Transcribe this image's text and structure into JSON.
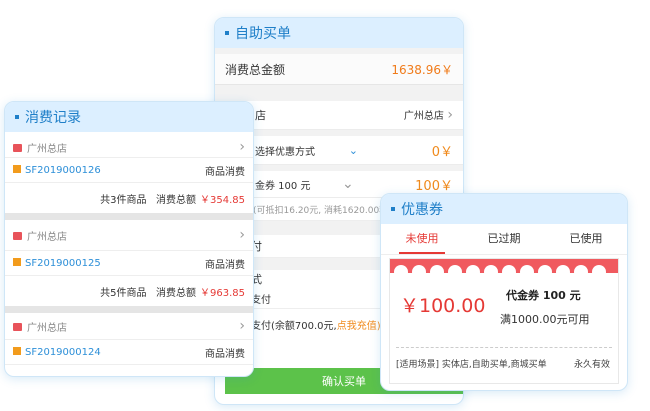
{
  "order": {
    "title": "自助买单",
    "total_label": "消费总金额",
    "total_value": "1638.96￥",
    "store_label": "店",
    "store_value": "广州总店",
    "discount_label": "选择优惠方式",
    "discount_value": "0￥",
    "coupon_label": "金券 100 元",
    "coupon_value": "100￥",
    "points_text": "(可抵扣16.20元, 消耗1620.00积",
    "pay_label_a": "付",
    "pay_label_b": "式",
    "pay_option_1": "支付",
    "pay_option_2": "支付(余额700.0元,",
    "recharge_link": "点我充值)",
    "confirm_button": "确认买单"
  },
  "records": {
    "title": "消费记录",
    "items": [
      {
        "shop": "广州总店",
        "order_no": "SF2019000126",
        "type": "商品消费",
        "summary": "共3件商品   消费总额",
        "total": "￥354.85"
      },
      {
        "shop": "广州总店",
        "order_no": "SF2019000125",
        "type": "商品消费",
        "summary": "共5件商品   消费总额",
        "total": "￥963.85"
      },
      {
        "shop": "广州总店",
        "order_no": "SF2019000124",
        "type": "商品消费"
      }
    ]
  },
  "coupons": {
    "title": "优惠券",
    "tabs": [
      "未使用",
      "已过期",
      "已使用"
    ],
    "card": {
      "amount": "￥100.00",
      "name": "代金券 100 元",
      "condition": "满1000.00元可用",
      "scene": "[适用场景] 实体店,自助买单,商城买单",
      "validity": "永久有效"
    }
  },
  "colors": {
    "accent": "#1f7fc8",
    "price_red": "#e53935",
    "confirm_green": "#5cc24a",
    "orange": "#f08a1c"
  }
}
